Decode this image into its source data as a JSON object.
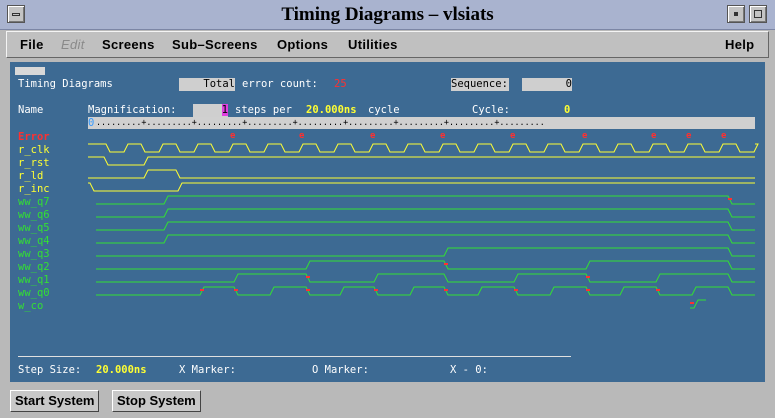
{
  "window": {
    "title": "Timing Diagrams – vlsiats"
  },
  "menu": {
    "file": "File",
    "edit": "Edit",
    "screens": "Screens",
    "subscreens": "Sub–Screens",
    "options": "Options",
    "utilities": "Utilities",
    "help": "Help"
  },
  "header": {
    "title": "Timing Diagrams",
    "total_label": "Total",
    "error_count_label": "error count:",
    "error_count": "25",
    "sequence_label": "Sequence:",
    "sequence_value": "0",
    "name_label": "Name",
    "magnification_label": "Magnification:",
    "magnification_value": "1",
    "steps_per_label": "steps per",
    "step_time": "20.000ns",
    "cycle_label": "cycle",
    "cycle_counter_label": "Cycle:",
    "cycle_value": "0"
  },
  "timeline": {
    "ruler": ".........+.........+.........+.........+.........+.........+.........+.........+.........",
    "cursor_marker": "0"
  },
  "signals": [
    {
      "name": "Error",
      "color": "#ff3030",
      "kind": "error",
      "bold": true
    },
    {
      "name": "r_clk",
      "color": "#ffff33",
      "kind": "input"
    },
    {
      "name": "r_rst",
      "color": "#ffff33",
      "kind": "input"
    },
    {
      "name": "r_ld",
      "color": "#ffff33",
      "kind": "input"
    },
    {
      "name": "r_inc",
      "color": "#ffff33",
      "kind": "input"
    },
    {
      "name": "ww_q7",
      "color": "#33e033",
      "kind": "output"
    },
    {
      "name": "ww_q6",
      "color": "#33e033",
      "kind": "output"
    },
    {
      "name": "ww_q5",
      "color": "#33e033",
      "kind": "output"
    },
    {
      "name": "ww_q4",
      "color": "#33e033",
      "kind": "output"
    },
    {
      "name": "ww_q3",
      "color": "#33e033",
      "kind": "output"
    },
    {
      "name": "ww_q2",
      "color": "#33e033",
      "kind": "output"
    },
    {
      "name": "ww_q1",
      "color": "#33e033",
      "kind": "output"
    },
    {
      "name": "ww_q0",
      "color": "#33e033",
      "kind": "output"
    },
    {
      "name": "w_co",
      "color": "#33e033",
      "kind": "output"
    }
  ],
  "status": {
    "step_size_label": "Step Size:",
    "step_size_value": "20.000ns",
    "x_marker_label": "X Marker:",
    "o_marker_label": "O Marker:",
    "x_minus_o_label": "X - 0:"
  },
  "buttons": {
    "start": "Start System",
    "stop": "Stop System"
  },
  "colors": {
    "panel": "#3d6a93",
    "input_trace": "#ffff33",
    "output_trace": "#33e033",
    "error": "#ff3030"
  }
}
